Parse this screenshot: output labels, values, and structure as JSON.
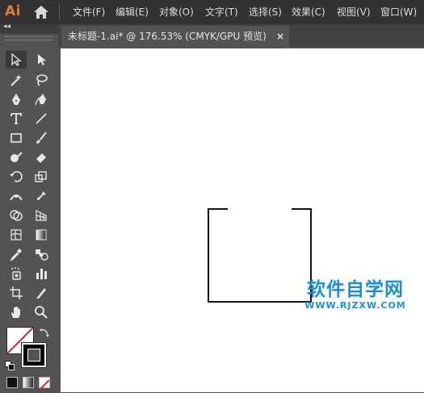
{
  "app": {
    "logo": "Ai"
  },
  "menubar": {
    "items": [
      "文件(F)",
      "编辑(E)",
      "对象(O)",
      "文字(T)",
      "选择(S)",
      "效果(C)",
      "视图(V)",
      "窗口(W)"
    ]
  },
  "panel": {
    "collapse_label": "◂◂"
  },
  "document": {
    "tab_label": "未标题-1.ai* @ 176.53% (CMYK/GPU 预览)",
    "close_label": "×"
  },
  "watermark": {
    "title": "软件自学网",
    "url": "WWW.RJZXW.COM"
  },
  "colors": {
    "menubar_bg": "#323232",
    "panel_bg": "#535353",
    "canvas_bg": "#ffffff",
    "accent_logo": "#E37A3A",
    "watermark": "#1a8fd6"
  },
  "tools": [
    "selection-tool-icon",
    "direct-selection-tool-icon",
    "magic-wand-tool-icon",
    "lasso-tool-icon",
    "pen-tool-icon",
    "curvature-tool-icon",
    "type-tool-icon",
    "line-segment-tool-icon",
    "rectangle-tool-icon",
    "paintbrush-tool-icon",
    "shaper-tool-icon",
    "eraser-tool-icon",
    "rotate-tool-icon",
    "scale-tool-icon",
    "width-tool-icon",
    "puppet-warp-tool-icon",
    "shape-builder-tool-icon",
    "perspective-grid-tool-icon",
    "mesh-tool-icon",
    "gradient-tool-icon",
    "eyedropper-tool-icon",
    "blend-tool-icon",
    "symbol-sprayer-tool-icon",
    "column-graph-tool-icon",
    "artboard-tool-icon",
    "slice-tool-icon",
    "hand-tool-icon",
    "zoom-tool-icon"
  ]
}
